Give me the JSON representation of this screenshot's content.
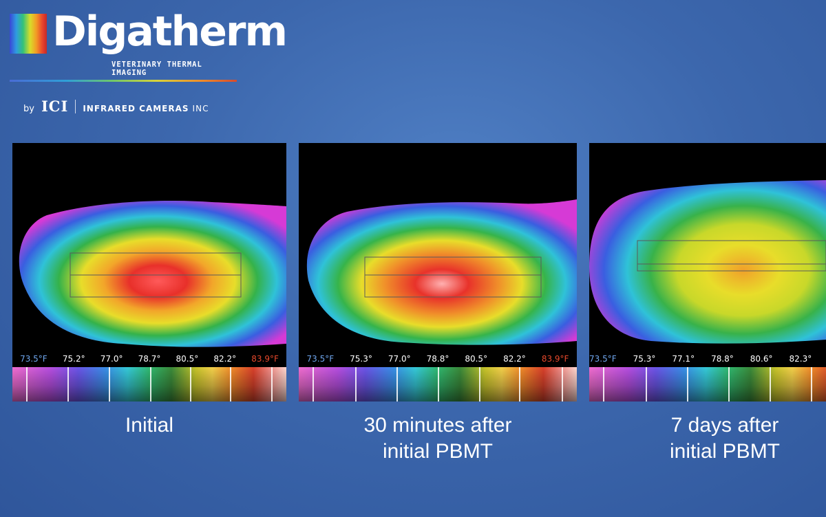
{
  "brand": {
    "name": "Digatherm",
    "tagline": "VETERINARY THERMAL IMAGING",
    "by": "by",
    "ici": "ICI",
    "company": "INFRARED CAMERAS",
    "company_suffix": "INC",
    "spectrum_icon": "spectrum-bars-icon"
  },
  "panels": [
    {
      "scale": [
        "73.5°F",
        "75.2°",
        "77.0°",
        "78.7°",
        "80.5°",
        "82.2°",
        "83.9°F"
      ],
      "caption": [
        "Initial"
      ]
    },
    {
      "scale": [
        "73.5°F",
        "75.3°",
        "77.0°",
        "78.8°",
        "80.5°",
        "82.2°",
        "83.9°F"
      ],
      "caption": [
        "30 minutes after",
        "initial PBMT"
      ]
    },
    {
      "scale": [
        "73.5°F",
        "75.3°",
        "77.1°",
        "78.8°",
        "80.6°",
        "82.3°"
      ],
      "caption": [
        "7 days after",
        "initial PBMT"
      ]
    }
  ],
  "colors": {
    "background": "#3c67ad",
    "scale_low": "#6fa6ee",
    "scale_high": "#e8492c"
  }
}
